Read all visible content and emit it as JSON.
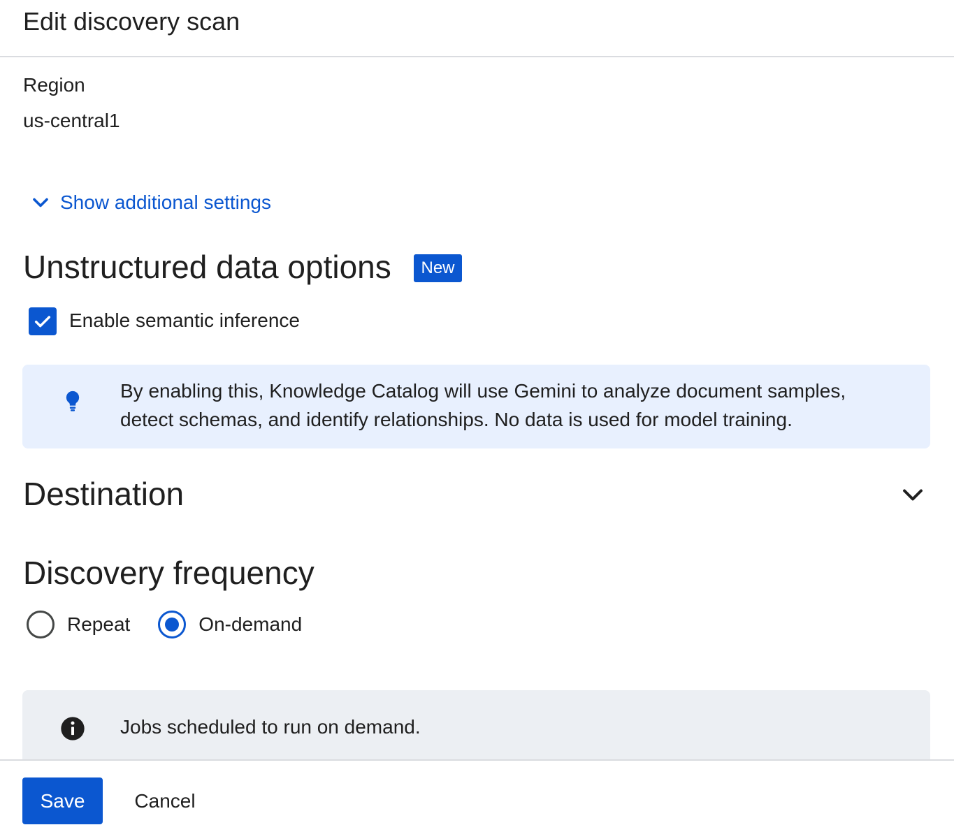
{
  "header": {
    "title": "Edit discovery scan"
  },
  "region": {
    "label": "Region",
    "value": "us-central1"
  },
  "additional_settings": {
    "label": "Show additional settings",
    "icon": "chevron-down-icon"
  },
  "unstructured": {
    "title": "Unstructured data options",
    "badge": "New",
    "checkbox_label": "Enable semantic inference",
    "checkbox_checked": true,
    "info_icon": "lightbulb-icon",
    "info_line1": "By enabling this, Knowledge Catalog will use Gemini to analyze document samples,",
    "info_line2": "detect schemas, and identify relationships. No data is used for model training."
  },
  "destination": {
    "title": "Destination",
    "icon": "chevron-down-icon"
  },
  "frequency": {
    "title": "Discovery frequency",
    "options": [
      {
        "label": "Repeat",
        "selected": false
      },
      {
        "label": "On-demand",
        "selected": true
      }
    ],
    "info_icon": "info-icon",
    "info_text": "Jobs scheduled to run on demand."
  },
  "footer": {
    "save_label": "Save",
    "cancel_label": "Cancel"
  },
  "colors": {
    "accent": "#0b57d0",
    "info_blue_bg": "#e8f0fe",
    "info_grey_bg": "#eceff3",
    "divider": "#dadce0"
  }
}
